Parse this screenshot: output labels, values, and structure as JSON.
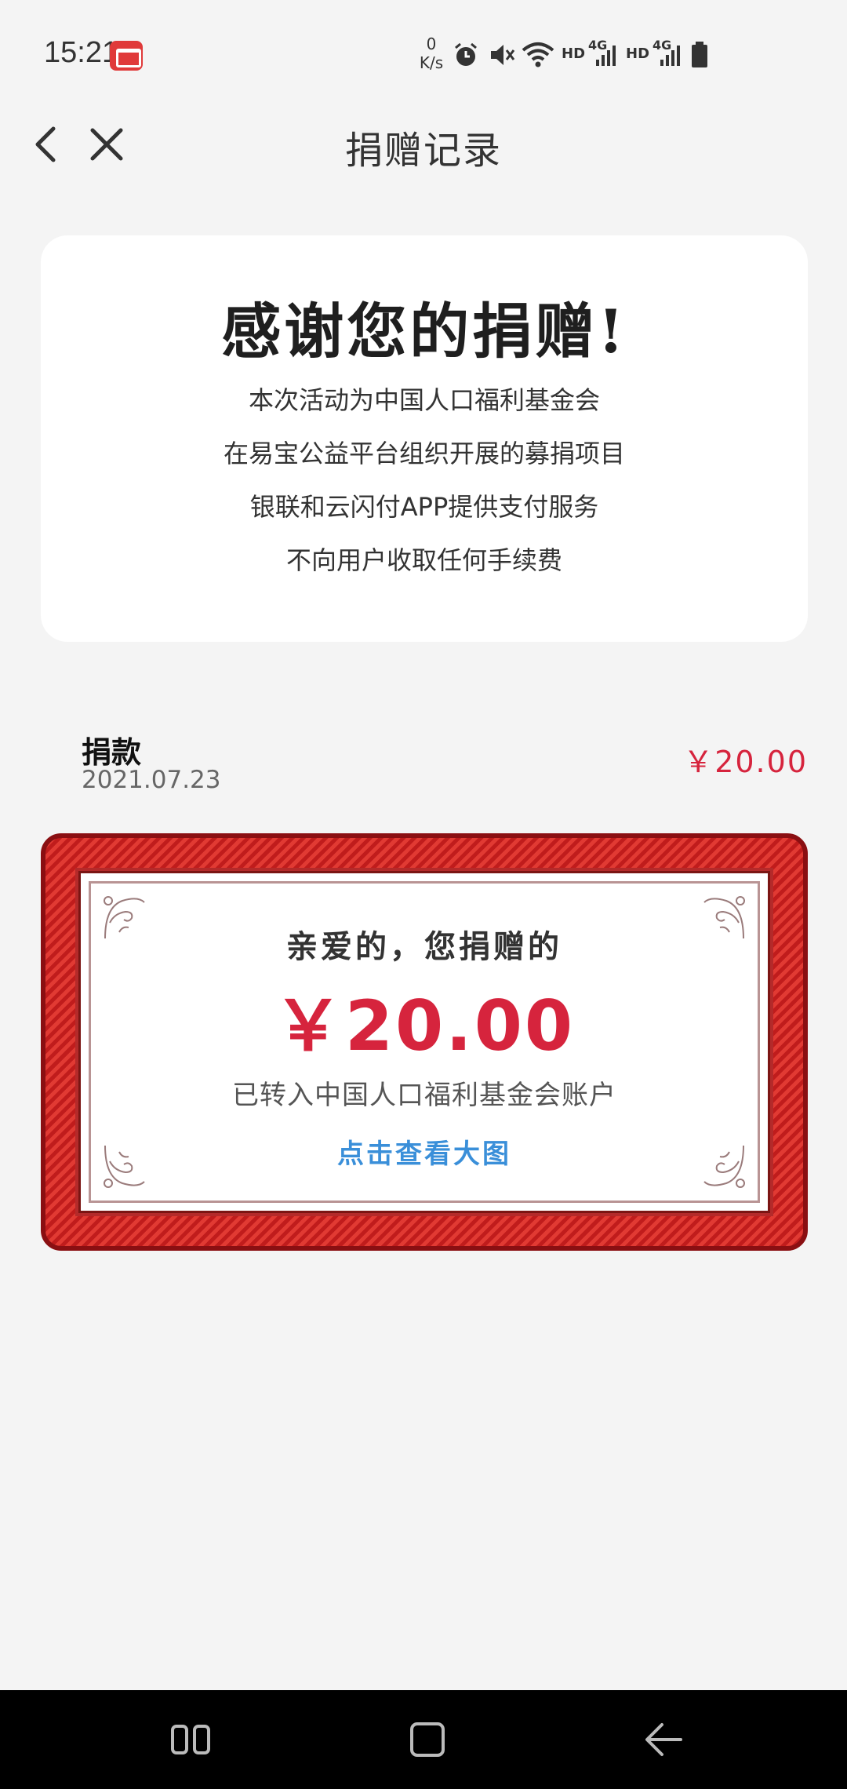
{
  "status_bar": {
    "time": "15:21",
    "net_speed_value": "0",
    "net_speed_unit": "K/s",
    "hd_label_1": "HD",
    "net_label_1": "4G",
    "hd_label_2": "HD",
    "net_label_2": "4G"
  },
  "nav": {
    "title": "捐赠记录"
  },
  "thanks_card": {
    "heading": "感谢您的捐赠!",
    "lines": [
      "本次活动为中国人口福利基金会",
      "在易宝公益平台组织开展的募捐项目",
      "银联和云闪付APP提供支付服务",
      "不向用户收取任何手续费"
    ]
  },
  "record": {
    "type": "捐款",
    "date": "2021.07.23",
    "amount": "￥20.00"
  },
  "certificate": {
    "greeting": "亲爱的，您捐赠的",
    "amount": "￥20.00",
    "description": "已转入中国人口福利基金会账户",
    "link": "点击查看大图"
  },
  "colors": {
    "accent_red": "#d6243d",
    "link_blue": "#3a8fd9",
    "cert_red": "#c9201f"
  }
}
